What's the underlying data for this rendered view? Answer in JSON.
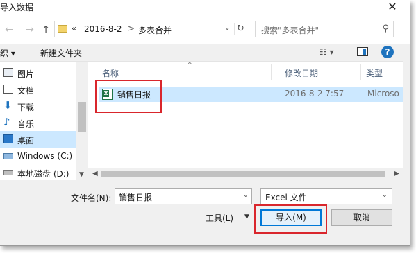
{
  "window": {
    "title": "导入数据",
    "close_icon": "close-icon"
  },
  "address": {
    "back_icon": "arrow-left-icon",
    "forward_icon": "arrow-right-icon",
    "up_icon": "arrow-up-icon",
    "more": "«",
    "crumbs": [
      "2016-8-2",
      "多表合并"
    ],
    "separator": ">",
    "refresh_icon": "refresh-icon"
  },
  "search": {
    "placeholder": "搜索\"多表合并\""
  },
  "toolbar": {
    "organize": "织 ▾",
    "new_folder": "新建文件夹",
    "view_icon": "view-options-icon",
    "preview_pane_icon": "preview-pane-icon",
    "help": "?"
  },
  "nav": {
    "items": [
      {
        "label": "图片",
        "icon": "pictures-icon"
      },
      {
        "label": "文档",
        "icon": "documents-icon"
      },
      {
        "label": "下载",
        "icon": "download-icon"
      },
      {
        "label": "音乐",
        "icon": "music-icon"
      },
      {
        "label": "桌面",
        "icon": "desktop-icon",
        "selected": true
      },
      {
        "label": "Windows (C:)",
        "icon": "drive-icon"
      },
      {
        "label": "本地磁盘 (D:)",
        "icon": "disk-icon"
      }
    ]
  },
  "filelist": {
    "columns": [
      "名称",
      "修改日期",
      "类型"
    ],
    "files": [
      {
        "name": "销售日报",
        "modified": "2016-8-2 7:57",
        "type": "Microso",
        "icon": "excel-file-icon",
        "selected": true
      }
    ]
  },
  "bottom": {
    "filename_label": "文件名(N):",
    "filename_value": "销售日报",
    "filetype_value": "Excel 文件",
    "tools_label": "工具(L)",
    "import_label": "导入(M)",
    "cancel_label": "取消"
  },
  "colors": {
    "selection": "#cce8ff",
    "accent": "#0078d7",
    "highlight_annotation": "#d9262c"
  }
}
